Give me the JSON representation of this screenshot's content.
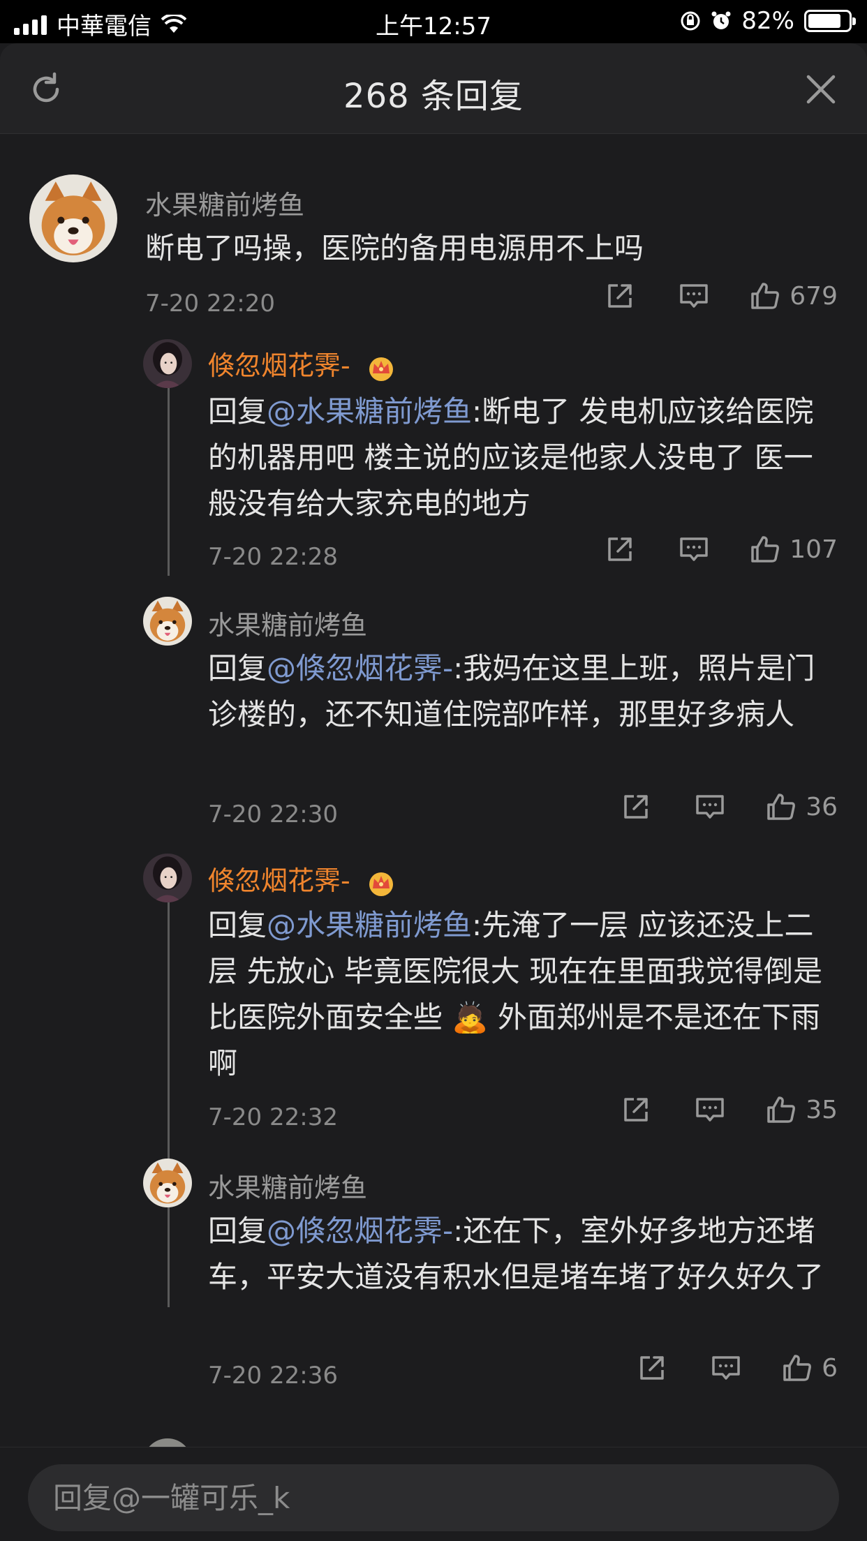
{
  "status_bar": {
    "carrier": "中華電信",
    "time": "上午12:57",
    "battery": "82%",
    "battery_level": 0.82
  },
  "header": {
    "title": "268 条回复"
  },
  "comments": [
    {
      "name": "水果糖前烤鱼",
      "text": "断电了吗操，医院的备用电源用不上吗",
      "time": "7-20 22:20",
      "likes": "679"
    },
    {
      "name": "倏忽烟花霁-",
      "reply_prefix": "回复",
      "mention": "@水果糖前烤鱼",
      "text": ":断电了 发电机应该给医院的机器用吧 楼主说的应该是他家人没电了 医一般没有给大家充电的地方",
      "time": "7-20 22:28",
      "likes": "107"
    },
    {
      "name": "水果糖前烤鱼",
      "reply_prefix": "回复",
      "mention": "@倏忽烟花霁-",
      "text": ":我妈在这里上班，照片是门诊楼的，还不知道住院部咋样，那里好多病人",
      "time": "7-20 22:30",
      "likes": "36"
    },
    {
      "name": "倏忽烟花霁-",
      "reply_prefix": "回复",
      "mention": "@水果糖前烤鱼",
      "text": ":先淹了一层 应该还没上二层 先放心 毕竟医院很大 现在在里面我觉得倒是比医院外面安全些 🙇 外面郑州是不是还在下雨啊",
      "time": "7-20 22:32",
      "likes": "35"
    },
    {
      "name": "水果糖前烤鱼",
      "reply_prefix": "回复",
      "mention": "@倏忽烟花霁-",
      "text": ":还在下，室外好多地方还堵车，平安大道没有积水但是堵车堵了好久好久了",
      "time": "7-20 22:36",
      "likes": "6"
    }
  ],
  "reply_box": {
    "placeholder": "回复@一罐可乐_k"
  },
  "icons": {
    "refresh": "refresh-icon",
    "close": "close-icon",
    "share": "share-icon",
    "comment": "comment-icon",
    "like": "thumbs-up-icon",
    "crown": "crown-badge-icon"
  },
  "colors": {
    "background": "#1c1c1e",
    "vip_name": "#f0852d",
    "mention": "#7f9ad0"
  }
}
